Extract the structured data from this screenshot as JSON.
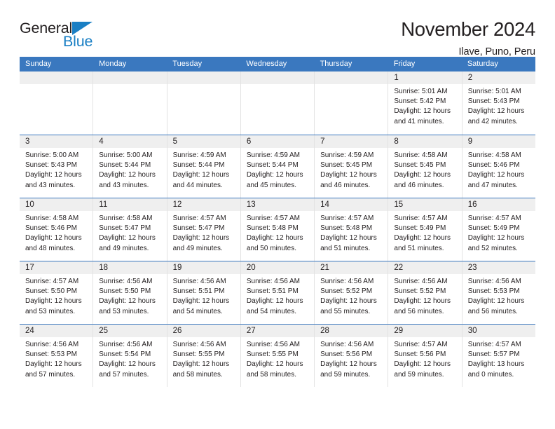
{
  "logo": {
    "word1": "General",
    "word2": "Blue",
    "triangle_icon": "blue-triangle-icon",
    "accent_color": "#1a7fc4"
  },
  "header": {
    "title": "November 2024",
    "location": "Ilave, Puno, Peru"
  },
  "calendar": {
    "header_color": "#3a78bf",
    "daynum_bg": "#efefef",
    "weekdays": [
      "Sunday",
      "Monday",
      "Tuesday",
      "Wednesday",
      "Thursday",
      "Friday",
      "Saturday"
    ],
    "weeks": [
      [
        {
          "day": "",
          "empty": true
        },
        {
          "day": "",
          "empty": true
        },
        {
          "day": "",
          "empty": true
        },
        {
          "day": "",
          "empty": true
        },
        {
          "day": "",
          "empty": true
        },
        {
          "day": "1",
          "sunrise": "Sunrise: 5:01 AM",
          "sunset": "Sunset: 5:42 PM",
          "daylight1": "Daylight: 12 hours",
          "daylight2": "and 41 minutes."
        },
        {
          "day": "2",
          "sunrise": "Sunrise: 5:01 AM",
          "sunset": "Sunset: 5:43 PM",
          "daylight1": "Daylight: 12 hours",
          "daylight2": "and 42 minutes."
        }
      ],
      [
        {
          "day": "3",
          "sunrise": "Sunrise: 5:00 AM",
          "sunset": "Sunset: 5:43 PM",
          "daylight1": "Daylight: 12 hours",
          "daylight2": "and 43 minutes."
        },
        {
          "day": "4",
          "sunrise": "Sunrise: 5:00 AM",
          "sunset": "Sunset: 5:44 PM",
          "daylight1": "Daylight: 12 hours",
          "daylight2": "and 43 minutes."
        },
        {
          "day": "5",
          "sunrise": "Sunrise: 4:59 AM",
          "sunset": "Sunset: 5:44 PM",
          "daylight1": "Daylight: 12 hours",
          "daylight2": "and 44 minutes."
        },
        {
          "day": "6",
          "sunrise": "Sunrise: 4:59 AM",
          "sunset": "Sunset: 5:44 PM",
          "daylight1": "Daylight: 12 hours",
          "daylight2": "and 45 minutes."
        },
        {
          "day": "7",
          "sunrise": "Sunrise: 4:59 AM",
          "sunset": "Sunset: 5:45 PM",
          "daylight1": "Daylight: 12 hours",
          "daylight2": "and 46 minutes."
        },
        {
          "day": "8",
          "sunrise": "Sunrise: 4:58 AM",
          "sunset": "Sunset: 5:45 PM",
          "daylight1": "Daylight: 12 hours",
          "daylight2": "and 46 minutes."
        },
        {
          "day": "9",
          "sunrise": "Sunrise: 4:58 AM",
          "sunset": "Sunset: 5:46 PM",
          "daylight1": "Daylight: 12 hours",
          "daylight2": "and 47 minutes."
        }
      ],
      [
        {
          "day": "10",
          "sunrise": "Sunrise: 4:58 AM",
          "sunset": "Sunset: 5:46 PM",
          "daylight1": "Daylight: 12 hours",
          "daylight2": "and 48 minutes."
        },
        {
          "day": "11",
          "sunrise": "Sunrise: 4:58 AM",
          "sunset": "Sunset: 5:47 PM",
          "daylight1": "Daylight: 12 hours",
          "daylight2": "and 49 minutes."
        },
        {
          "day": "12",
          "sunrise": "Sunrise: 4:57 AM",
          "sunset": "Sunset: 5:47 PM",
          "daylight1": "Daylight: 12 hours",
          "daylight2": "and 49 minutes."
        },
        {
          "day": "13",
          "sunrise": "Sunrise: 4:57 AM",
          "sunset": "Sunset: 5:48 PM",
          "daylight1": "Daylight: 12 hours",
          "daylight2": "and 50 minutes."
        },
        {
          "day": "14",
          "sunrise": "Sunrise: 4:57 AM",
          "sunset": "Sunset: 5:48 PM",
          "daylight1": "Daylight: 12 hours",
          "daylight2": "and 51 minutes."
        },
        {
          "day": "15",
          "sunrise": "Sunrise: 4:57 AM",
          "sunset": "Sunset: 5:49 PM",
          "daylight1": "Daylight: 12 hours",
          "daylight2": "and 51 minutes."
        },
        {
          "day": "16",
          "sunrise": "Sunrise: 4:57 AM",
          "sunset": "Sunset: 5:49 PM",
          "daylight1": "Daylight: 12 hours",
          "daylight2": "and 52 minutes."
        }
      ],
      [
        {
          "day": "17",
          "sunrise": "Sunrise: 4:57 AM",
          "sunset": "Sunset: 5:50 PM",
          "daylight1": "Daylight: 12 hours",
          "daylight2": "and 53 minutes."
        },
        {
          "day": "18",
          "sunrise": "Sunrise: 4:56 AM",
          "sunset": "Sunset: 5:50 PM",
          "daylight1": "Daylight: 12 hours",
          "daylight2": "and 53 minutes."
        },
        {
          "day": "19",
          "sunrise": "Sunrise: 4:56 AM",
          "sunset": "Sunset: 5:51 PM",
          "daylight1": "Daylight: 12 hours",
          "daylight2": "and 54 minutes."
        },
        {
          "day": "20",
          "sunrise": "Sunrise: 4:56 AM",
          "sunset": "Sunset: 5:51 PM",
          "daylight1": "Daylight: 12 hours",
          "daylight2": "and 54 minutes."
        },
        {
          "day": "21",
          "sunrise": "Sunrise: 4:56 AM",
          "sunset": "Sunset: 5:52 PM",
          "daylight1": "Daylight: 12 hours",
          "daylight2": "and 55 minutes."
        },
        {
          "day": "22",
          "sunrise": "Sunrise: 4:56 AM",
          "sunset": "Sunset: 5:52 PM",
          "daylight1": "Daylight: 12 hours",
          "daylight2": "and 56 minutes."
        },
        {
          "day": "23",
          "sunrise": "Sunrise: 4:56 AM",
          "sunset": "Sunset: 5:53 PM",
          "daylight1": "Daylight: 12 hours",
          "daylight2": "and 56 minutes."
        }
      ],
      [
        {
          "day": "24",
          "sunrise": "Sunrise: 4:56 AM",
          "sunset": "Sunset: 5:53 PM",
          "daylight1": "Daylight: 12 hours",
          "daylight2": "and 57 minutes."
        },
        {
          "day": "25",
          "sunrise": "Sunrise: 4:56 AM",
          "sunset": "Sunset: 5:54 PM",
          "daylight1": "Daylight: 12 hours",
          "daylight2": "and 57 minutes."
        },
        {
          "day": "26",
          "sunrise": "Sunrise: 4:56 AM",
          "sunset": "Sunset: 5:55 PM",
          "daylight1": "Daylight: 12 hours",
          "daylight2": "and 58 minutes."
        },
        {
          "day": "27",
          "sunrise": "Sunrise: 4:56 AM",
          "sunset": "Sunset: 5:55 PM",
          "daylight1": "Daylight: 12 hours",
          "daylight2": "and 58 minutes."
        },
        {
          "day": "28",
          "sunrise": "Sunrise: 4:56 AM",
          "sunset": "Sunset: 5:56 PM",
          "daylight1": "Daylight: 12 hours",
          "daylight2": "and 59 minutes."
        },
        {
          "day": "29",
          "sunrise": "Sunrise: 4:57 AM",
          "sunset": "Sunset: 5:56 PM",
          "daylight1": "Daylight: 12 hours",
          "daylight2": "and 59 minutes."
        },
        {
          "day": "30",
          "sunrise": "Sunrise: 4:57 AM",
          "sunset": "Sunset: 5:57 PM",
          "daylight1": "Daylight: 13 hours",
          "daylight2": "and 0 minutes."
        }
      ]
    ]
  }
}
